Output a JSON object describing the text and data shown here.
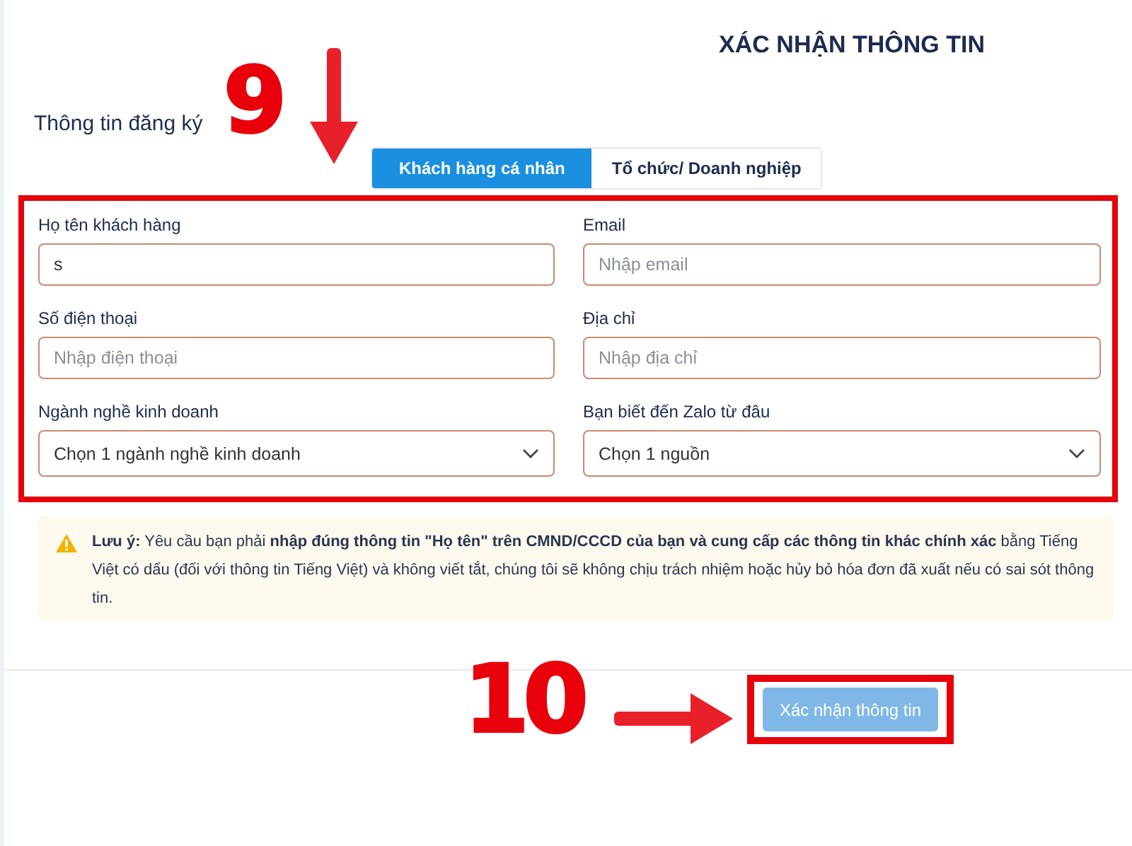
{
  "page_title": "XÁC NHẬN THÔNG TIN",
  "section_title": "Thông tin đăng ký",
  "tabs": [
    {
      "label": "Khách hàng cá nhân",
      "selected": true
    },
    {
      "label": "Tổ chức/ Doanh nghiệp",
      "selected": false
    }
  ],
  "fields": [
    {
      "kind": "input",
      "label": "Họ tên khách hàng",
      "value": "s"
    },
    {
      "kind": "input",
      "label": "Email",
      "placeholder": "Nhập email"
    },
    {
      "kind": "input",
      "label": "Số điện thoại",
      "placeholder": "Nhập điện thoại"
    },
    {
      "kind": "input",
      "label": "Địa chỉ",
      "placeholder": "Nhập địa chỉ"
    },
    {
      "kind": "select",
      "label": "Ngành nghề kinh doanh",
      "value": "Chọn 1 ngành nghề kinh doanh"
    },
    {
      "kind": "select",
      "label": "Bạn biết đến Zalo từ đâu",
      "value": "Chọn 1 nguồn"
    }
  ],
  "notice": "**Lưu ý:** Yêu cầu bạn phải **nhập đúng thông tin \"Họ tên\" trên CMND/CCCD của bạn và cung cấp các thông tin khác chính xác** bằng Tiếng Việt có dấu (đối với thông tin Tiếng Việt) và không viết tắt, chúng tôi sẽ không chịu trách nhiệm hoặc hủy bỏ hóa đơn đã xuất nếu có sai sót thông tin.",
  "submit_button": {
    "label": "Xác nhận thông tin",
    "disabled": true
  },
  "annotations": [
    {
      "number": "9",
      "kind": "down"
    },
    {
      "number": "10",
      "kind": "right"
    }
  ]
}
